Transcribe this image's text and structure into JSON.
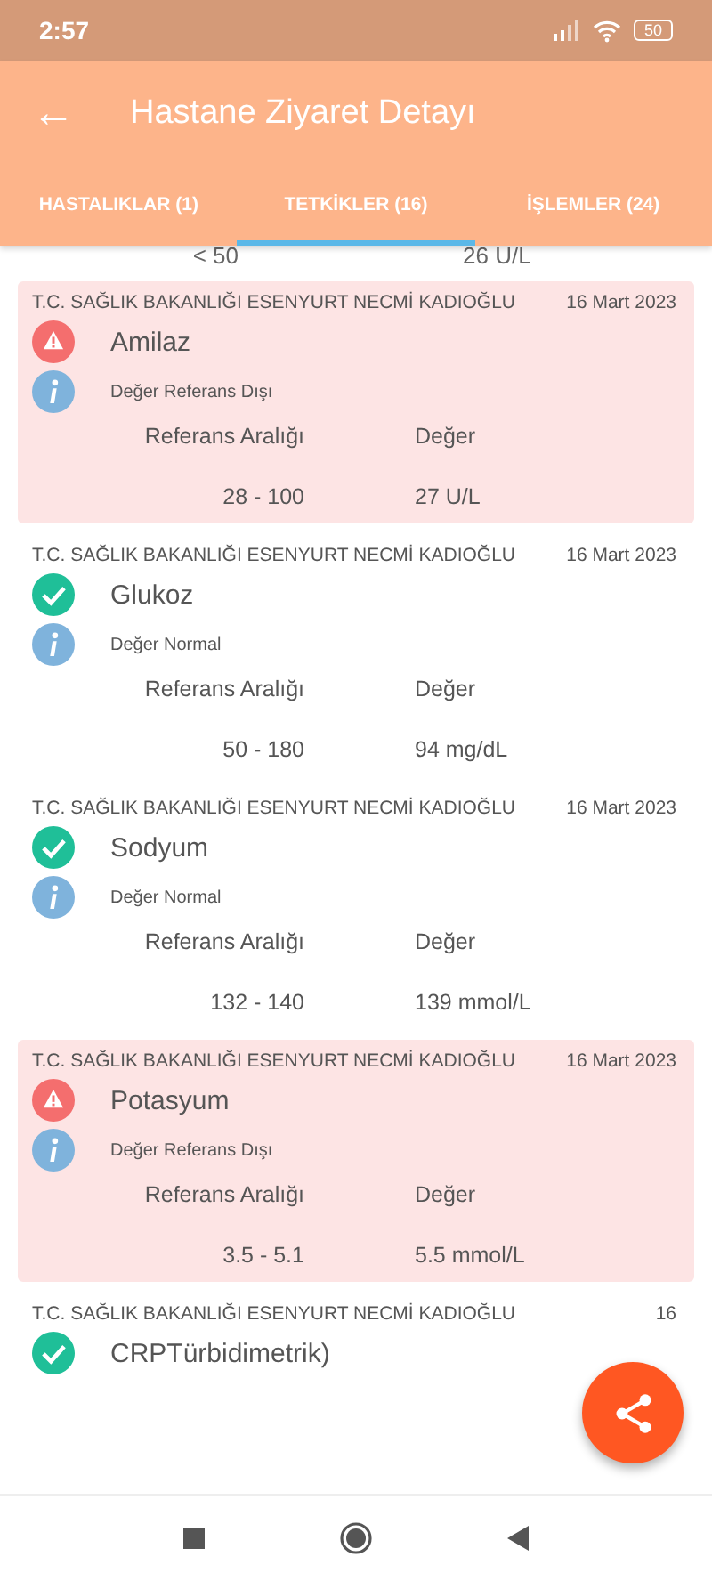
{
  "status_bar": {
    "time": "2:57",
    "battery": "50"
  },
  "app_bar": {
    "back_icon": "←",
    "title": "Hastane Ziyaret Detayı"
  },
  "tabs": [
    {
      "label": "HASTALIKLAR (1)",
      "selected": false
    },
    {
      "label": "TETKİKLER (16)",
      "selected": true
    },
    {
      "label": "İŞLEMLER (24)",
      "selected": false
    }
  ],
  "partial_row": {
    "range": "< 50",
    "value": "26 U/L"
  },
  "tests": [
    {
      "hospital": "T.C. SAĞLIK BAKANLIĞI ESENYURT NECMİ KADIOĞLU",
      "date": "16 Mart 2023",
      "name": "Amilaz",
      "kind": "abnormal",
      "note": "Değer Referans Dışı",
      "range_label": "Referans Aralığı",
      "value_label": "Değer",
      "range": "28 - 100",
      "value": "27 U/L"
    },
    {
      "hospital": "T.C. SAĞLIK BAKANLIĞI ESENYURT NECMİ KADIOĞLU",
      "date": "16 Mart 2023",
      "name": "Glukoz",
      "kind": "normal",
      "note": "Değer Normal",
      "range_label": "Referans Aralığı",
      "value_label": "Değer",
      "range": "50 - 180",
      "value": "94 mg/dL"
    },
    {
      "hospital": "T.C. SAĞLIK BAKANLIĞI ESENYURT NECMİ KADIOĞLU",
      "date": "16 Mart 2023",
      "name": "Sodyum",
      "kind": "normal",
      "note": "Değer Normal",
      "range_label": "Referans Aralığı",
      "value_label": "Değer",
      "range": "132 - 140",
      "value": "139 mmol/L"
    },
    {
      "hospital": "T.C. SAĞLIK BAKANLIĞI ESENYURT NECMİ KADIOĞLU",
      "date": "16 Mart 2023",
      "name": "Potasyum",
      "kind": "abnormal",
      "note": "Değer Referans Dışı",
      "range_label": "Referans Aralığı",
      "value_label": "Değer",
      "range": "3.5 - 5.1",
      "value": "5.5 mmol/L"
    },
    {
      "hospital": "T.C. SAĞLIK BAKANLIĞI ESENYURT NECMİ KADIOĞLU",
      "date": "16",
      "name": "CRPTürbidimetrik)",
      "kind": "normal"
    }
  ]
}
